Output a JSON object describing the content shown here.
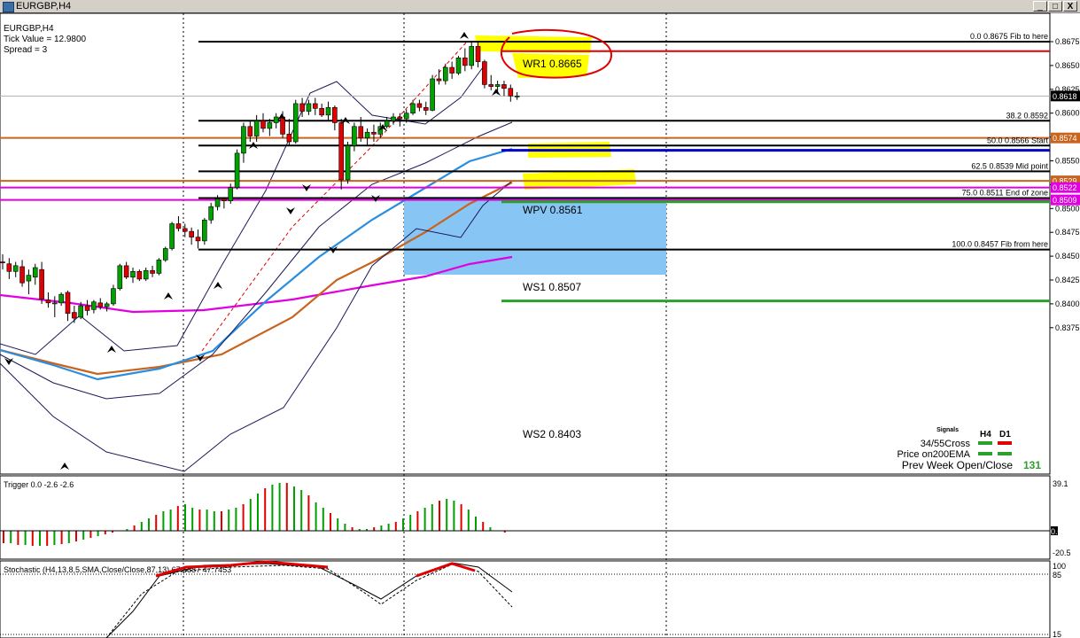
{
  "window": {
    "title": "EURGBP,H4",
    "buttons": {
      "minimize": "_",
      "maximize": "□",
      "close": "X"
    }
  },
  "info": {
    "symbol": "EURGBP,H4",
    "tick_value": "Tick Value = 12.9800",
    "spread": "Spread = 3"
  },
  "fib_labels": [
    {
      "text": "0.0   0.8675   Fib to here"
    },
    {
      "text": "38.2  0.8592"
    },
    {
      "text": "50.0   0.8566   Start"
    },
    {
      "text": "62.5   0.8539   Mid point"
    },
    {
      "text": "75.0   0.8511   End of zone"
    },
    {
      "text": "100.0  0.8457   Fib from here"
    }
  ],
  "pivot_labels": {
    "wr1": "WR1   0.8665",
    "wpv": "WPV   0.8561",
    "ws1": "WS1   0.8507",
    "ws2": "WS2   0.8403"
  },
  "price_tags": {
    "current": "0.8618",
    "tag_8574": "0.8574",
    "tag_8529": "0.8529",
    "tag_8522": "0.8522",
    "tag_8509": "0.8509"
  },
  "signals": {
    "title": "Signals",
    "h4": "H4",
    "d1": "D1",
    "row1": "34/55Cross",
    "row2": "Price on200EMA",
    "row3": "Prev Week Open/Close",
    "row3_value": "131"
  },
  "trigger": {
    "label": "Trigger 0.0 -2.6 -2.6",
    "ticks": [
      "39.1",
      "0.00",
      "-20.5"
    ]
  },
  "stochastic": {
    "label": "Stochastic (H4,13,8,5,SMA,Close/Close,87,13) 67.5887 47.7453",
    "ticks": [
      "100",
      "85",
      "15"
    ]
  },
  "chart_data": {
    "type": "candlestick",
    "symbol": "EURGBP",
    "timeframe": "H4",
    "y_ticks": [
      0.8675,
      0.865,
      0.8625,
      0.86,
      0.8575,
      0.855,
      0.8525,
      0.85,
      0.8475,
      0.845,
      0.8425,
      0.84,
      0.8375
    ],
    "ylim": [
      0.8365,
      0.869
    ],
    "fib_levels": [
      {
        "ratio": 0.0,
        "price": 0.8675,
        "note": "Fib to here"
      },
      {
        "ratio": 38.2,
        "price": 0.8592,
        "note": ""
      },
      {
        "ratio": 50.0,
        "price": 0.8566,
        "note": "Start"
      },
      {
        "ratio": 62.5,
        "price": 0.8539,
        "note": "Mid point"
      },
      {
        "ratio": 75.0,
        "price": 0.8511,
        "note": "End of zone"
      },
      {
        "ratio": 100.0,
        "price": 0.8457,
        "note": "Fib from here"
      }
    ],
    "weekly_pivots": {
      "WR1": 0.8665,
      "WPV": 0.8561,
      "WS1": 0.8507,
      "WS2": 0.8403
    },
    "horizontal_lines": [
      {
        "price": 0.8574,
        "color": "#c8641e"
      },
      {
        "price": 0.8529,
        "color": "#c8641e"
      },
      {
        "price": 0.8522,
        "color": "#e000e0"
      },
      {
        "price": 0.8509,
        "color": "#e000e0"
      }
    ],
    "current_price": 0.8618,
    "candles": [
      [
        0.8444,
        0.8452,
        0.8436,
        0.8443
      ],
      [
        0.8442,
        0.8448,
        0.8426,
        0.8434
      ],
      [
        0.8434,
        0.8444,
        0.8428,
        0.844
      ],
      [
        0.8439,
        0.8446,
        0.8418,
        0.8422
      ],
      [
        0.8424,
        0.8436,
        0.841,
        0.843
      ],
      [
        0.8428,
        0.8442,
        0.842,
        0.8438
      ],
      [
        0.8436,
        0.8444,
        0.84,
        0.8405
      ],
      [
        0.8404,
        0.8412,
        0.8396,
        0.8401
      ],
      [
        0.84,
        0.8408,
        0.8386,
        0.8401
      ],
      [
        0.8401,
        0.8412,
        0.8398,
        0.841
      ],
      [
        0.8412,
        0.8414,
        0.8382,
        0.839
      ],
      [
        0.8391,
        0.8398,
        0.838,
        0.8385
      ],
      [
        0.8386,
        0.8402,
        0.8384,
        0.8398
      ],
      [
        0.8398,
        0.8404,
        0.8388,
        0.8393
      ],
      [
        0.8394,
        0.8404,
        0.839,
        0.8402
      ],
      [
        0.8401,
        0.8406,
        0.8394,
        0.8397
      ],
      [
        0.8397,
        0.8402,
        0.8392,
        0.84
      ],
      [
        0.84,
        0.842,
        0.8398,
        0.8416
      ],
      [
        0.8416,
        0.8442,
        0.8414,
        0.844
      ],
      [
        0.844,
        0.8444,
        0.8426,
        0.8428
      ],
      [
        0.8428,
        0.8438,
        0.8422,
        0.8434
      ],
      [
        0.8434,
        0.8436,
        0.8424,
        0.8426
      ],
      [
        0.8426,
        0.8438,
        0.8424,
        0.8435
      ],
      [
        0.8435,
        0.844,
        0.8428,
        0.8432
      ],
      [
        0.8432,
        0.8448,
        0.843,
        0.8446
      ],
      [
        0.8446,
        0.846,
        0.8444,
        0.8458
      ],
      [
        0.8458,
        0.8486,
        0.8456,
        0.8484
      ],
      [
        0.8484,
        0.8492,
        0.8476,
        0.8479
      ],
      [
        0.8479,
        0.8484,
        0.847,
        0.8476
      ],
      [
        0.8476,
        0.848,
        0.8462,
        0.847
      ],
      [
        0.847,
        0.8478,
        0.8458,
        0.8466
      ],
      [
        0.8466,
        0.849,
        0.8462,
        0.8488
      ],
      [
        0.8488,
        0.8506,
        0.8484,
        0.8502
      ],
      [
        0.8502,
        0.8514,
        0.8498,
        0.851
      ],
      [
        0.851,
        0.8512,
        0.85,
        0.8508
      ],
      [
        0.8508,
        0.8526,
        0.8505,
        0.8522
      ],
      [
        0.8522,
        0.8562,
        0.852,
        0.8558
      ],
      [
        0.8558,
        0.859,
        0.8548,
        0.8586
      ],
      [
        0.8586,
        0.8592,
        0.857,
        0.8576
      ],
      [
        0.8576,
        0.8598,
        0.857,
        0.8592
      ],
      [
        0.8592,
        0.86,
        0.858,
        0.8584
      ],
      [
        0.8584,
        0.8594,
        0.8576,
        0.859
      ],
      [
        0.859,
        0.86,
        0.8584,
        0.8596
      ],
      [
        0.8596,
        0.8602,
        0.8574,
        0.8578
      ],
      [
        0.8578,
        0.8594,
        0.8566,
        0.857
      ],
      [
        0.857,
        0.8614,
        0.8568,
        0.861
      ],
      [
        0.861,
        0.8616,
        0.8596,
        0.8602
      ],
      [
        0.8602,
        0.8614,
        0.8598,
        0.861
      ],
      [
        0.861,
        0.8616,
        0.8598,
        0.8605
      ],
      [
        0.8605,
        0.861,
        0.8596,
        0.8598
      ],
      [
        0.8598,
        0.8612,
        0.8592,
        0.8606
      ],
      [
        0.8606,
        0.8608,
        0.8582,
        0.859
      ],
      [
        0.859,
        0.8594,
        0.852,
        0.853
      ],
      [
        0.853,
        0.857,
        0.8526,
        0.8566
      ],
      [
        0.8566,
        0.859,
        0.856,
        0.8586
      ],
      [
        0.8586,
        0.8596,
        0.857,
        0.8574
      ],
      [
        0.8574,
        0.8584,
        0.8566,
        0.858
      ],
      [
        0.858,
        0.8588,
        0.857,
        0.8578
      ],
      [
        0.8578,
        0.859,
        0.8574,
        0.8586
      ],
      [
        0.8586,
        0.8596,
        0.8584,
        0.8592
      ],
      [
        0.8592,
        0.86,
        0.8588,
        0.8596
      ],
      [
        0.8596,
        0.86,
        0.8586,
        0.8594
      ],
      [
        0.8594,
        0.8604,
        0.859,
        0.86
      ],
      [
        0.86,
        0.8614,
        0.8598,
        0.861
      ],
      [
        0.861,
        0.8614,
        0.8602,
        0.8606
      ],
      [
        0.8606,
        0.8612,
        0.8598,
        0.8603
      ],
      [
        0.8603,
        0.864,
        0.8602,
        0.8636
      ],
      [
        0.8636,
        0.8646,
        0.863,
        0.8634
      ],
      [
        0.8634,
        0.8652,
        0.863,
        0.8648
      ],
      [
        0.8648,
        0.8654,
        0.8636,
        0.8642
      ],
      [
        0.8642,
        0.866,
        0.864,
        0.8658
      ],
      [
        0.8658,
        0.8668,
        0.8644,
        0.865
      ],
      [
        0.865,
        0.8676,
        0.8646,
        0.867
      ],
      [
        0.867,
        0.8675,
        0.8648,
        0.8654
      ],
      [
        0.8654,
        0.8656,
        0.8626,
        0.863
      ],
      [
        0.863,
        0.864,
        0.8624,
        0.8628
      ],
      [
        0.8628,
        0.8634,
        0.862,
        0.863
      ],
      [
        0.863,
        0.8634,
        0.8618,
        0.8626
      ],
      [
        0.8626,
        0.863,
        0.8612,
        0.8618
      ],
      [
        0.8618,
        0.8622,
        0.8614,
        0.8618
      ]
    ]
  }
}
